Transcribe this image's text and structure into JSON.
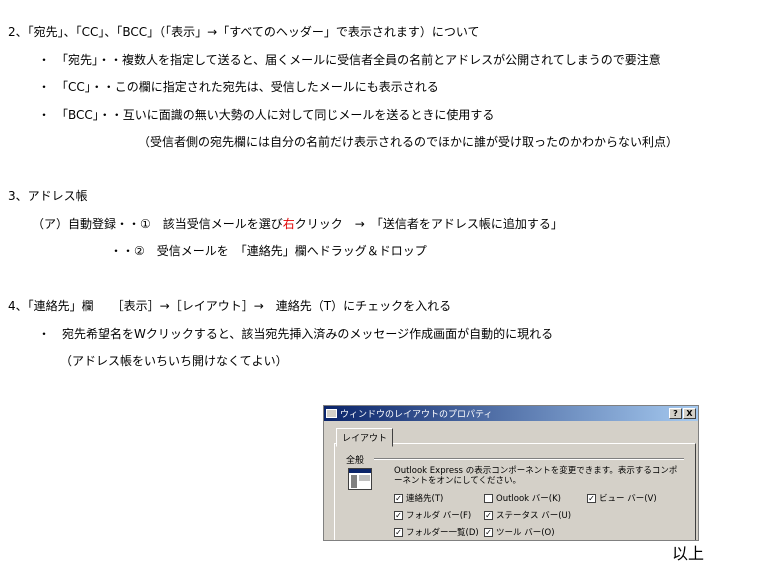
{
  "document": {
    "lines": [
      {
        "id": "sec2-heading",
        "text": "2、「宛先」、「CC」、「BCC」（「表示」→「すべてのヘッダー」で表示されます）について"
      },
      {
        "id": "sec2-item1",
        "text": "・　「宛先」・・複数人を指定して送ると、届くメールに受信者全員の名前とアドレスが公開されてしまうので要注意"
      },
      {
        "id": "sec2-item2",
        "text": "・　「CC」・・この欄に指定された宛先は、受信したメールにも表示される"
      },
      {
        "id": "sec2-item3",
        "text": "・　「BCC」・・互いに面識の無い大勢の人に対して同じメールを送るときに使用する"
      },
      {
        "id": "sec2-note",
        "text": "（受信者側の宛先欄には自分の名前だけ表示されるのでほかに誰が受け取ったのかわからない利点）"
      },
      {
        "id": "sec3-heading",
        "text": "3、アドレス帳"
      },
      {
        "id": "sec3-item1-a",
        "text": "（ア）自動登録・・①　該当受信メールを選び"
      },
      {
        "id": "sec3-item1-red",
        "text": "右"
      },
      {
        "id": "sec3-item1-b",
        "text": "クリック　→　「送信者をアドレス帳に追加する」"
      },
      {
        "id": "sec3-item2",
        "text": "・・②　受信メールを　「連絡先」欄へドラッグ＆ドロップ"
      },
      {
        "id": "sec4-heading",
        "text": "4、「連絡先」欄　　［表示］→［レイアウト］→　連絡先（T）にチェックを入れる"
      },
      {
        "id": "sec4-item1",
        "text": "・　宛先希望名をWクリックすると、該当宛先挿入済みのメッセージ作成画面が自動的に現れる"
      },
      {
        "id": "sec4-note",
        "text": "（アドレス帳をいちいち開けなくてよい）"
      },
      {
        "id": "closing",
        "text": "以上"
      }
    ]
  },
  "dialog": {
    "title": "ウィンドウのレイアウトのプロパティ",
    "help_button": "?",
    "close_button": "X",
    "tab_label": "レイアウト",
    "group_label": "全般",
    "description": "Outlook Express の表示コンポーネントを変更できます。表示するコンポーネントをオンにしてください。",
    "options": [
      {
        "label": "連絡先(T)",
        "checked": true
      },
      {
        "label": "Outlook バー(K)",
        "checked": false
      },
      {
        "label": "ビュー バー(V)",
        "checked": true
      },
      {
        "label": "フォルダ バー(F)",
        "checked": true
      },
      {
        "label": "ステータス バー(U)",
        "checked": true
      },
      {
        "label": "フォルダー一覧(D)",
        "checked": true
      },
      {
        "label": "ツール バー(O)",
        "checked": true
      }
    ]
  },
  "colors": {
    "emphasis": "#e00000",
    "titlebar": "#0a246a",
    "dialog_bg": "#d4d0c8"
  }
}
